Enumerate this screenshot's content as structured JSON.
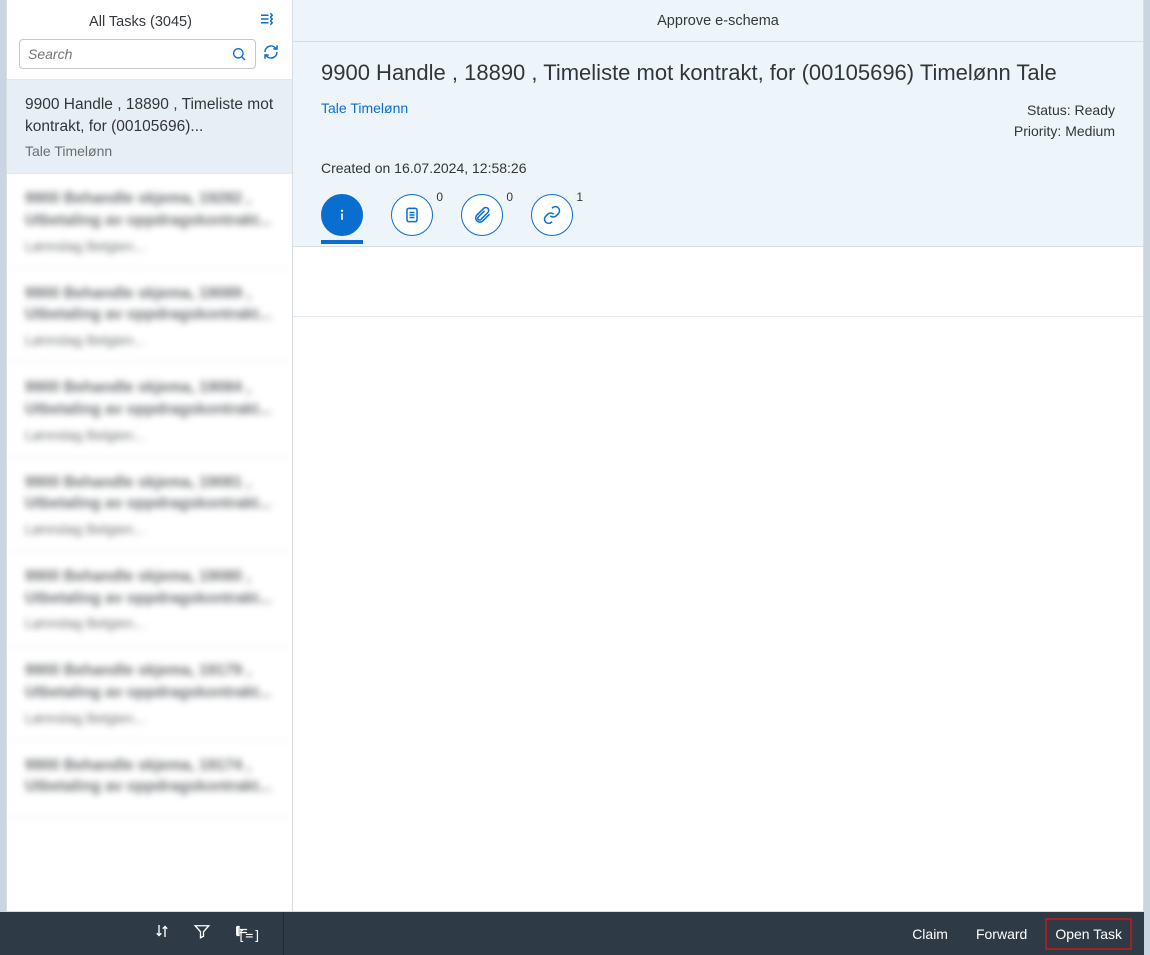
{
  "sidebar": {
    "title": "All Tasks (3045)",
    "search_placeholder": "Search",
    "items": [
      {
        "title": "9900 Handle , 18890 , Timeliste mot kontrakt, for (00105696)...",
        "sub": "Tale Timelønn",
        "selected": true,
        "blurred": false
      },
      {
        "title": "9900 Behandle skjema, 19282 , Utbetaling av oppdragskontrakt...",
        "sub": "Lønnslag Belgien...",
        "selected": false,
        "blurred": true
      },
      {
        "title": "9900 Behandle skjema, 19089 , Utbetaling av oppdragskontrakt...",
        "sub": "Lønnslag Belgien...",
        "selected": false,
        "blurred": true
      },
      {
        "title": "9900 Behandle skjema, 19084 , Utbetaling av oppdragskontrakt...",
        "sub": "Lønnslag Belgien...",
        "selected": false,
        "blurred": true
      },
      {
        "title": "9900 Behandle skjema, 19081 , Utbetaling av oppdragskontrakt...",
        "sub": "Lønnslag Belgien...",
        "selected": false,
        "blurred": true
      },
      {
        "title": "9900 Behandle skjema, 19080 , Utbetaling av oppdragskontrakt...",
        "sub": "Lønnslag Belgien...",
        "selected": false,
        "blurred": true
      },
      {
        "title": "9900 Behandle skjema, 19179 , Utbetaling av oppdragskontrakt...",
        "sub": "Lønnslag Belgien...",
        "selected": false,
        "blurred": true
      },
      {
        "title": "9900 Behandle skjema, 19174 , Utbetaling av oppdragskontrakt...",
        "sub": "",
        "selected": false,
        "blurred": true
      }
    ]
  },
  "main": {
    "header": "Approve e-schema",
    "title": "9900 Handle , 18890 , Timeliste mot kontrakt, for (00105696) Timelønn Tale",
    "author": "Tale Timelønn",
    "status_label": "Status:",
    "status_value": "Ready",
    "priority_label": "Priority:",
    "priority_value": "Medium",
    "created": "Created on 16.07.2024, 12:58:26",
    "tabs": {
      "notes_count": "0",
      "attachments_count": "0",
      "links_count": "1"
    }
  },
  "footer": {
    "claim": "Claim",
    "forward": "Forward",
    "open_task": "Open Task"
  }
}
